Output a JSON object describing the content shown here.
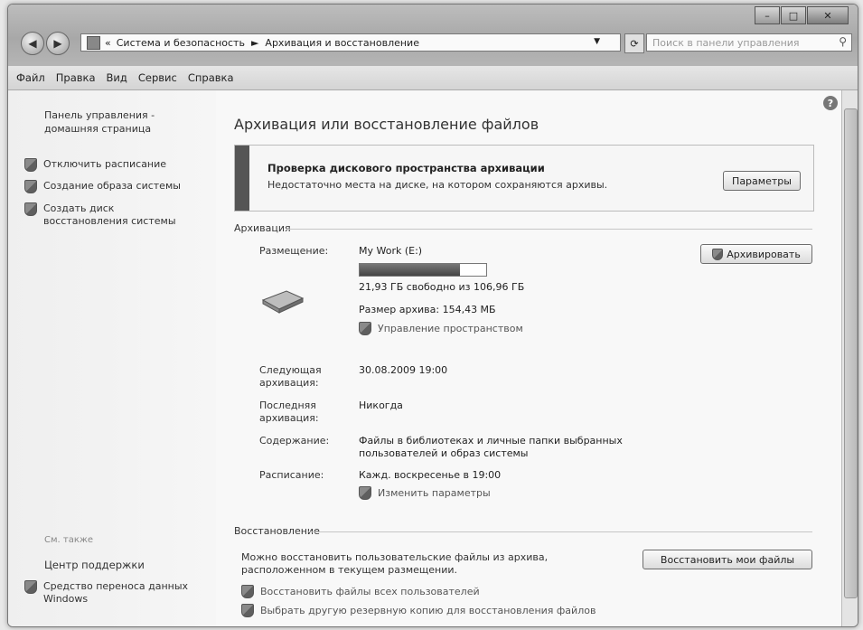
{
  "window": {
    "controls": [
      "–",
      "□",
      "✕"
    ]
  },
  "address": {
    "prefix": "«",
    "crumbs": [
      "Система и безопасность",
      "Архивация и восстановление"
    ],
    "separator": "►",
    "search_placeholder": "Поиск в панели управления"
  },
  "menu": [
    "Файл",
    "Правка",
    "Вид",
    "Сервис",
    "Справка"
  ],
  "sidebar": {
    "home": "Панель управления - домашняя страница",
    "tasks": [
      "Отключить расписание",
      "Создание образа системы",
      "Создать диск восстановления системы"
    ],
    "see_also": "См. также",
    "links": [
      "Центр поддержки",
      "Средство переноса данных Windows"
    ]
  },
  "main": {
    "title": "Архивация или восстановление файлов",
    "alert": {
      "title": "Проверка дискового пространства архивации",
      "text": "Недостаточно места на диске, на котором сохраняются архивы.",
      "button": "Параметры"
    },
    "backup": {
      "section": "Архивация",
      "location_label": "Размещение:",
      "location_value": "My Work (E:)",
      "disk_used_fraction": 0.79,
      "free_text": "21,93 ГБ свободно из 106,96 ГБ",
      "archive_size": "Размер архива: 154,43 МБ",
      "manage_link": "Управление пространством",
      "backup_button": "Архивировать",
      "next_label": "Следующая архивация:",
      "next_value": "30.08.2009 19:00",
      "last_label": "Последняя архивация:",
      "last_value": "Никогда",
      "contents_label": "Содержание:",
      "contents_value": "Файлы в библиотеках и личные папки выбранных пользователей и образ системы",
      "schedule_label": "Расписание:",
      "schedule_value": "Кажд. воскресенье в 19:00",
      "change_link": "Изменить параметры"
    },
    "restore": {
      "section": "Восстановление",
      "text": "Можно восстановить пользовательские файлы из архива, расположенном в текущем размещении.",
      "button": "Восстановить мои файлы",
      "link_all": "Восстановить файлы всех пользователей",
      "link_other": "Выбрать другую резервную копию для восстановления файлов"
    }
  }
}
